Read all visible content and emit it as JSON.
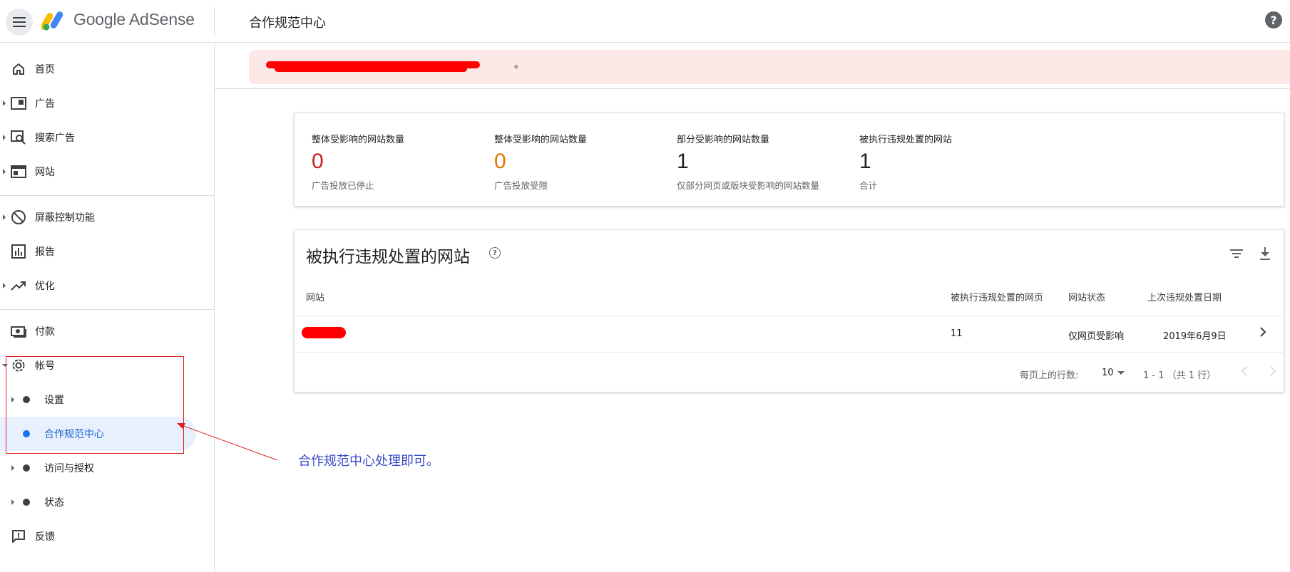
{
  "app": {
    "brand": "Google AdSense",
    "page_title": "合作规范中心",
    "help_icon": "help-circle-icon",
    "menu_icon": "hamburger-menu-icon"
  },
  "sidebar": {
    "items": [
      {
        "label": "首页",
        "icon": "home-icon"
      },
      {
        "label": "广告",
        "icon": "ads-icon"
      },
      {
        "label": "搜索广告",
        "icon": "search-ads-icon"
      },
      {
        "label": "网站",
        "icon": "sites-icon"
      },
      {
        "label": "屏蔽控制功能",
        "icon": "block-icon"
      },
      {
        "label": "报告",
        "icon": "report-icon"
      },
      {
        "label": "优化",
        "icon": "trending-up-icon"
      },
      {
        "label": "付款",
        "icon": "payments-icon"
      },
      {
        "label": "帐号",
        "icon": "gear-icon"
      },
      {
        "label": "设置"
      },
      {
        "label": "合作规范中心"
      },
      {
        "label": "访问与授权"
      },
      {
        "label": "状态"
      },
      {
        "label": "反馈",
        "icon": "feedback-icon"
      }
    ],
    "active": "合作规范中心"
  },
  "alert": {
    "trailing_text": "。"
  },
  "stats": [
    {
      "label": "整体受影响的网站数量",
      "value": "0",
      "note": "广告投放已停止",
      "color": "#c5221f"
    },
    {
      "label": "整体受影响的网站数量",
      "value": "0",
      "note": "广告投放受限",
      "color": "#e37400"
    },
    {
      "label": "部分受影响的网站数量",
      "value": "1",
      "note": "仅部分网页或版块受影响的网站数量",
      "color": "#202124"
    },
    {
      "label": "被执行违规处置的网站",
      "value": "1",
      "note": "合计",
      "color": "#202124"
    }
  ],
  "table": {
    "title": "被执行违规处置的网站",
    "columns": [
      "网站",
      "被执行违规处置的网页",
      "网站状态",
      "上次违规处置日期"
    ],
    "rows": [
      {
        "site": "",
        "pages": "11",
        "status": "仅网页受影响",
        "date": "2019年6月9日"
      }
    ],
    "pager": {
      "rows_per_page_label": "每页上的行数:",
      "rows_per_page": "10",
      "range": "1 - 1 （共 1 行）"
    }
  },
  "annotation": {
    "text": "合作规范中心处理即可。",
    "color": "#e0201e"
  }
}
